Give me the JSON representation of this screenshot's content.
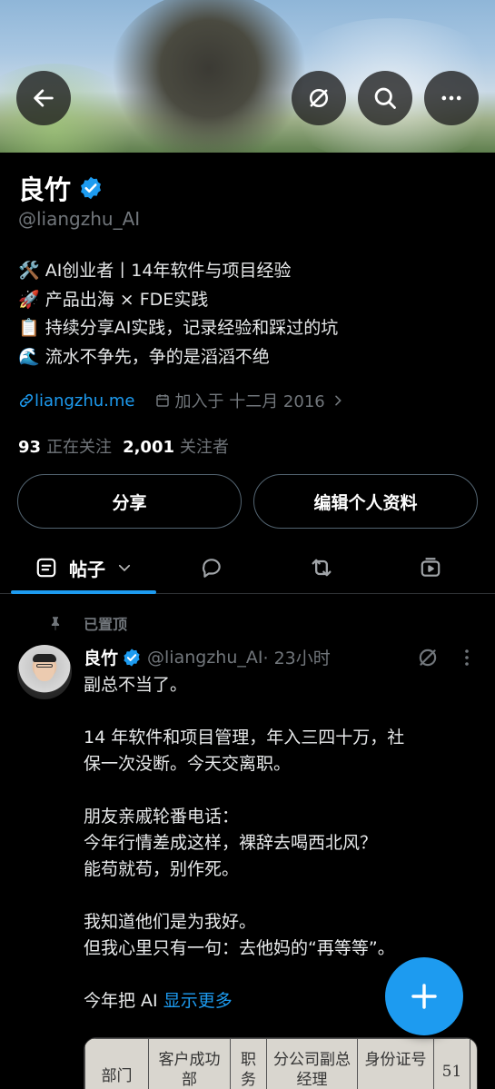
{
  "header": {
    "back_icon": "arrow-left-icon",
    "grok_icon": "grok-icon",
    "search_icon": "search-icon",
    "more_icon": "more-horizontal-icon"
  },
  "profile": {
    "name": "良竹",
    "handle": "@liangzhu_AI",
    "bio_lines": [
      "🛠️ AI创业者丨14年软件与项目经验",
      "🚀 产品出海 × FDE实践",
      "📋 持续分享AI实践，记录经验和踩过的坑",
      "🌊 流水不争先，争的是滔滔不绝"
    ],
    "website": "liangzhu.me",
    "joined": "加入于 十二月 2016",
    "following_count": "93",
    "following_label": "正在关注",
    "followers_count": "2,001",
    "followers_label": "关注者",
    "share_label": "分享",
    "edit_label": "编辑个人资料"
  },
  "tabs": {
    "posts_label": "帖子"
  },
  "pinned_post": {
    "pinned_label": "已置顶",
    "author": "良竹",
    "handle": "@liangzhu_AI",
    "time": "· 23小时",
    "lines": [
      "副总不当了。",
      "",
      "14 年软件和项目管理，年入三四十万，社",
      "保一次没断。今天交离职。",
      "",
      "朋友亲戚轮番电话：",
      "今年行情差成这样，裸辞去喝西北风？",
      "能苟就苟，别作死。",
      "",
      "我知道他们是为我好。",
      "但我心里只有一句：去他妈的“再等等”。",
      "",
      "今年把 AI"
    ],
    "show_more": "显示更多",
    "image_cells": [
      "部门",
      "客户成功部",
      "职务",
      "分公司副总经理",
      "身份证号",
      "51"
    ]
  },
  "colors": {
    "accent": "#1d9bf0",
    "background": "#000000",
    "muted": "#71767b"
  }
}
